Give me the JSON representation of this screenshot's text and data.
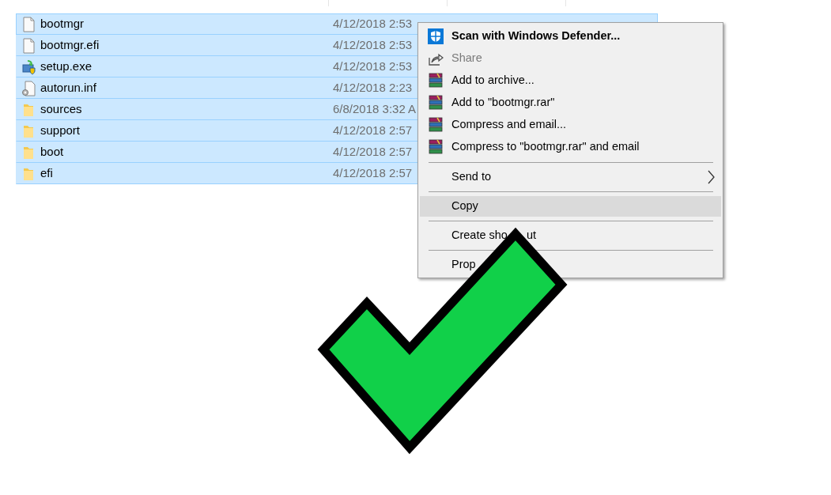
{
  "files": [
    {
      "name": "bootmgr",
      "kind": "file",
      "modified": "4/12/2018 2:53",
      "selected": true,
      "focused": true
    },
    {
      "name": "bootmgr.efi",
      "kind": "file",
      "modified": "4/12/2018 2:53",
      "selected": true,
      "focused": false
    },
    {
      "name": "setup.exe",
      "kind": "setup",
      "modified": "4/12/2018 2:53",
      "selected": true,
      "focused": false
    },
    {
      "name": "autorun.inf",
      "kind": "settings-file",
      "modified": "4/12/2018 2:23",
      "selected": true,
      "focused": false
    },
    {
      "name": "sources",
      "kind": "folder",
      "modified": "6/8/2018 3:32 A",
      "selected": true,
      "focused": false
    },
    {
      "name": "support",
      "kind": "folder",
      "modified": "4/12/2018 2:57",
      "selected": true,
      "focused": false
    },
    {
      "name": "boot",
      "kind": "folder",
      "modified": "4/12/2018 2:57",
      "selected": true,
      "focused": false
    },
    {
      "name": "efi",
      "kind": "folder",
      "modified": "4/12/2018 2:57",
      "selected": true,
      "focused": false
    }
  ],
  "context_menu": [
    {
      "kind": "defender",
      "label_parts": [
        "Scan with Windows Defender..."
      ],
      "default": true,
      "disabled": false,
      "selected": false
    },
    {
      "kind": "share",
      "label_parts": [
        "Share"
      ],
      "default": false,
      "disabled": true,
      "selected": false
    },
    {
      "kind": "archive",
      "label_parts": [
        "Add to archive..."
      ],
      "default": false,
      "disabled": false,
      "selected": false
    },
    {
      "kind": "archive",
      "label_parts": [
        "Add to \"bootmgr.rar\""
      ],
      "default": false,
      "disabled": false,
      "selected": false
    },
    {
      "kind": "archive",
      "label_parts": [
        "Compress and email..."
      ],
      "default": false,
      "disabled": false,
      "selected": false
    },
    {
      "kind": "archive",
      "label_parts": [
        "Compress to \"bootmgr.rar\" and email"
      ],
      "default": false,
      "disabled": false,
      "selected": false
    },
    {
      "kind": "separator"
    },
    {
      "kind": "submenu",
      "label_parts": [
        "Send to"
      ],
      "default": false,
      "disabled": false,
      "selected": false
    },
    {
      "kind": "separator"
    },
    {
      "kind": "plain",
      "label_parts": [
        "Copy"
      ],
      "default": false,
      "disabled": false,
      "selected": true
    },
    {
      "kind": "separator"
    },
    {
      "kind": "plain",
      "label_parts": [
        "Create sho",
        "ut"
      ],
      "default": false,
      "disabled": false,
      "selected": false
    },
    {
      "kind": "separator"
    },
    {
      "kind": "plain",
      "label_parts": [
        "Prop"
      ],
      "default": false,
      "disabled": false,
      "selected": false
    }
  ]
}
